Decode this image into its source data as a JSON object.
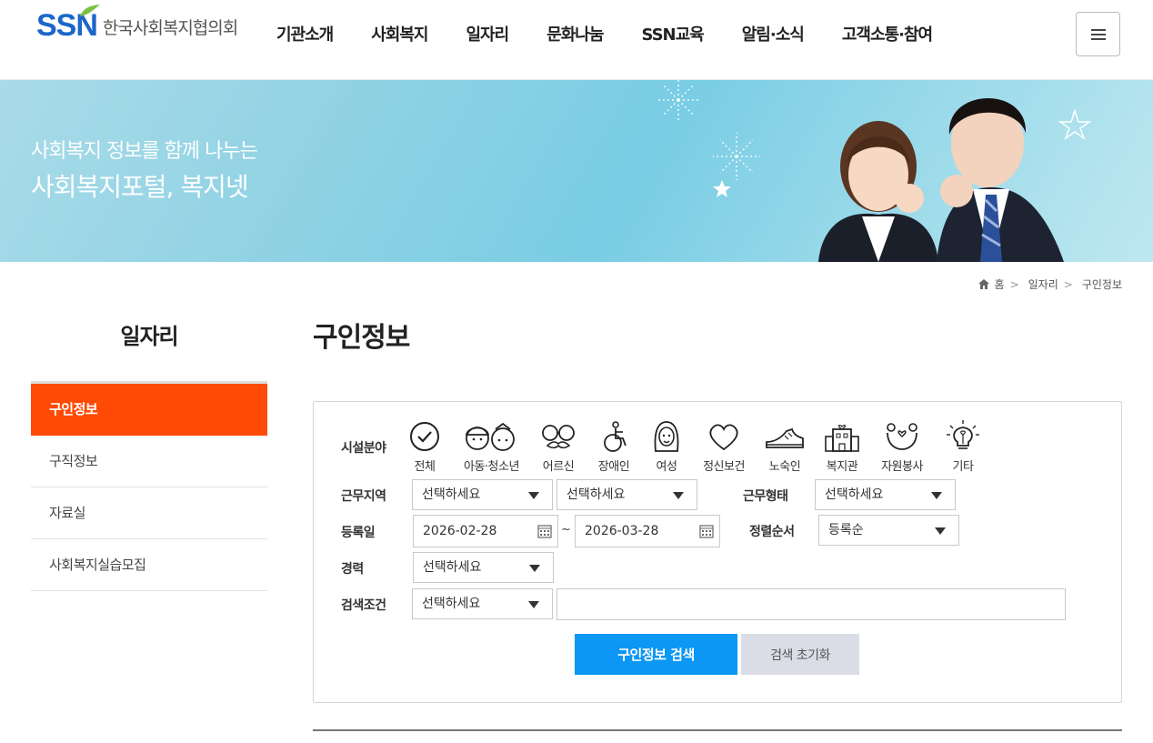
{
  "header": {
    "logo_ssn": "SSN",
    "logo_text": "한국사회복지협의회",
    "nav": [
      "기관소개",
      "사회복지",
      "일자리",
      "문화나눔",
      "SSN교육",
      "알림·소식",
      "고객소통·참여"
    ]
  },
  "banner": {
    "subtitle": "사회복지 정보를 함께 나누는",
    "title": "사회복지포털, 복지넷"
  },
  "breadcrumb": [
    "홈",
    "일자리",
    "구인정보"
  ],
  "sidebar": {
    "title": "일자리",
    "items": [
      "구인정보",
      "구직정보",
      "자료실",
      "사회복지실습모집"
    ],
    "active_index": 0
  },
  "page_title": "구인정보",
  "search": {
    "facility_label": "시설분야",
    "categories": [
      {
        "label": "전체",
        "icon": "check-circle-icon"
      },
      {
        "label": "아동·청소년",
        "icon": "children-icon"
      },
      {
        "label": "어르신",
        "icon": "glasses-mustache-icon"
      },
      {
        "label": "장애인",
        "icon": "wheelchair-icon"
      },
      {
        "label": "여성",
        "icon": "woman-icon"
      },
      {
        "label": "정신보건",
        "icon": "heart-icon"
      },
      {
        "label": "노숙인",
        "icon": "shoe-icon"
      },
      {
        "label": "복지관",
        "icon": "building-icon"
      },
      {
        "label": "자원봉사",
        "icon": "helping-hands-icon"
      },
      {
        "label": "기타",
        "icon": "lightbulb-icon"
      }
    ],
    "region_label": "근무지역",
    "region1": "선택하세요",
    "region2": "선택하세요",
    "worktype_label": "근무형태",
    "worktype": "선택하세요",
    "date_label": "등록일",
    "date_from": "2026-02-28",
    "date_sep": "~",
    "date_to": "2026-03-28",
    "sort_label": "정렬순서",
    "sort": "등록순",
    "career_label": "경력",
    "career": "선택하세요",
    "condition_label": "검색조건",
    "condition": "선택하세요",
    "keyword": "",
    "search_button": "구인정보 검색",
    "reset_button": "검색 초기화"
  },
  "colors": {
    "brand_blue": "#1b66c9",
    "active_orange": "#ff4a05",
    "search_blue": "#0b97f3"
  }
}
